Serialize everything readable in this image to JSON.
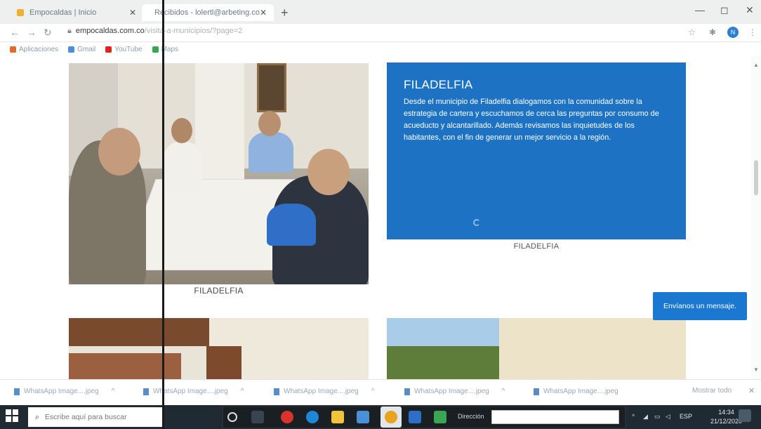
{
  "browser": {
    "tabs": [
      {
        "label": "Empocaldas | Inicio",
        "favicon_color": "#f0b030"
      },
      {
        "label": "Recibidos - lolertl@arbeting.co",
        "favicon_color": "#d93025"
      }
    ],
    "url_host": "empocaldas.com.co",
    "url_rest": "/visita-a-municipios/?page=2",
    "profile_initial": "N",
    "bookmarks": [
      {
        "label": "Aplicaciones",
        "color": "#e06c2a"
      },
      {
        "label": "Gmail",
        "color": "#4a90d9"
      },
      {
        "label": "YouTube",
        "color": "#e62117"
      },
      {
        "label": "Maps",
        "color": "#34a853"
      }
    ]
  },
  "content": {
    "card1": {
      "caption": "FILADELFIA"
    },
    "card2": {
      "title": "FILADELFIA",
      "text": "Desde el municipio de Filadelfia dialogamos con la comunidad sobre la estrategia de cartera y escuchamos de cerca las preguntas por consumo de acueducto y alcantarillado. Además revisamos las inquietudes de los habitantes, con el fin de generar un mejor servicio a la región.",
      "caption": "FILADELFIA"
    },
    "chat_button": "Envíanos un mensaje."
  },
  "downloads": {
    "items": [
      "WhatsApp Image....jpeg",
      "WhatsApp Image....jpeg",
      "WhatsApp Image....jpeg",
      "WhatsApp Image....jpeg",
      "WhatsApp Image....jpeg"
    ],
    "show_all": "Mostrar todo"
  },
  "taskbar": {
    "search_placeholder": "Escribe aquí para buscar",
    "address_label": "Dirección",
    "language": "ESP",
    "time": "14:34",
    "date": "21/12/2020"
  },
  "colors": {
    "accent_blue": "#1d72c4",
    "chat_blue": "#1b78d0",
    "taskbar": "#1f2a33"
  }
}
